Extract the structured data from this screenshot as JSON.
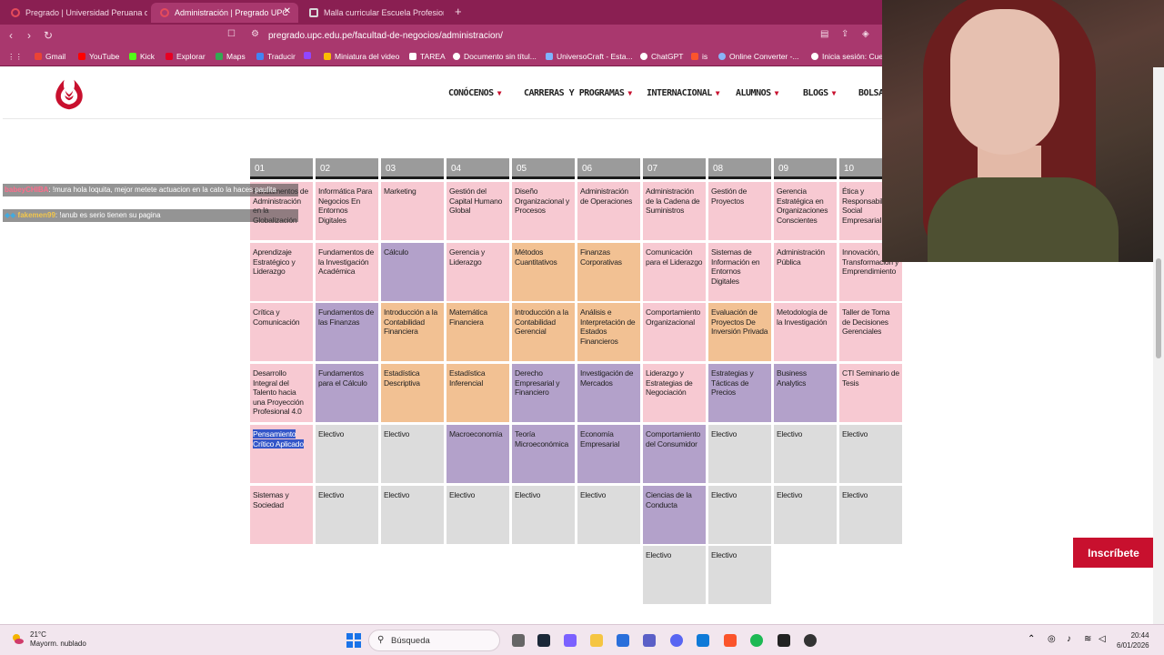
{
  "browser": {
    "tabs": [
      {
        "label": "Pregrado | Universidad Peruana de C",
        "active": false
      },
      {
        "label": "Administración | Pregrado UPC",
        "active": true
      },
      {
        "label": "Malla curricular Escuela Profesional A",
        "active": false
      }
    ],
    "new_tab": "+",
    "url": "pregrado.upc.edu.pe/facultad-de-negocios/administracion/",
    "bookmarks": [
      "Gmail",
      "YouTube",
      "Kick",
      "Explorar",
      "Maps",
      "Traducir",
      "Miniatura del video",
      "TAREA",
      "Documento sin títul...",
      "UniversoCraft - Esta...",
      "ChatGPT",
      "is",
      "Online Converter -...",
      "Inicia sesión: Cuen"
    ]
  },
  "site": {
    "menu": [
      "CONÓCENOS",
      "CARRERAS Y PROGRAMAS",
      "INTERNACIONAL",
      "ALUMNOS",
      "BLOGS",
      "BOLSA"
    ],
    "cta": "Inscríbete",
    "brand_color": "#c8102e"
  },
  "curriculum": {
    "headers": [
      "01",
      "02",
      "03",
      "04",
      "05",
      "06",
      "07",
      "08",
      "09",
      "10"
    ],
    "columns": [
      [
        {
          "text": "Fundamentos de Administración en la Globalización",
          "color": "pink"
        },
        {
          "text": "Aprendizaje Estratégico y Liderazgo",
          "color": "pink"
        },
        {
          "text": "Crítica y Comunicación",
          "color": "pink"
        },
        {
          "text": "Desarrollo Integral del Talento hacia una Proyección Profesional 4.0",
          "color": "pink"
        },
        {
          "text": "Pensamiento Crítico Aplicado",
          "color": "pink"
        },
        {
          "text": "Sistemas y Sociedad",
          "color": "pink"
        }
      ],
      [
        {
          "text": "Informática Para Negocios En Entornos Digitales",
          "color": "pink"
        },
        {
          "text": "Fundamentos de la Investigación Académica",
          "color": "pink"
        },
        {
          "text": "Fundamentos de las Finanzas",
          "color": "purple"
        },
        {
          "text": "Fundamentos para el Cálculo",
          "color": "purple"
        },
        {
          "text": "Electivo",
          "color": "grey"
        },
        {
          "text": "Electivo",
          "color": "grey"
        }
      ],
      [
        {
          "text": "Marketing",
          "color": "pink"
        },
        {
          "text": "Cálculo",
          "color": "purple"
        },
        {
          "text": "Introducción a la Contabilidad Financiera",
          "color": "orange"
        },
        {
          "text": "Estadística Descriptiva",
          "color": "orange"
        },
        {
          "text": "Electivo",
          "color": "grey"
        },
        {
          "text": "Electivo",
          "color": "grey"
        }
      ],
      [
        {
          "text": "Gestión del Capital Humano Global",
          "color": "pink"
        },
        {
          "text": "Gerencia y Liderazgo",
          "color": "pink"
        },
        {
          "text": "Matemática Financiera",
          "color": "orange"
        },
        {
          "text": "Estadística Inferencial",
          "color": "orange"
        },
        {
          "text": "Macroeconomía",
          "color": "purple"
        },
        {
          "text": "Electivo",
          "color": "grey"
        }
      ],
      [
        {
          "text": "Diseño Organizacional y Procesos",
          "color": "pink"
        },
        {
          "text": "Métodos Cuantitativos",
          "color": "orange"
        },
        {
          "text": "Introducción a la Contabilidad Gerencial",
          "color": "orange"
        },
        {
          "text": "Derecho Empresarial y Financiero",
          "color": "purple"
        },
        {
          "text": "Teoría Microeconómica",
          "color": "purple"
        },
        {
          "text": "Electivo",
          "color": "grey"
        }
      ],
      [
        {
          "text": "Administración de Operaciones",
          "color": "pink"
        },
        {
          "text": "Finanzas Corporativas",
          "color": "orange"
        },
        {
          "text": "Análisis e Interpretación de Estados Financieros",
          "color": "orange"
        },
        {
          "text": "Investigación de Mercados",
          "color": "purple"
        },
        {
          "text": "Economía Empresarial",
          "color": "purple"
        },
        {
          "text": "Electivo",
          "color": "grey"
        }
      ],
      [
        {
          "text": "Administración de la Cadena de Suministros",
          "color": "pink"
        },
        {
          "text": "Comunicación para el Liderazgo",
          "color": "pink"
        },
        {
          "text": "Comportamiento Organizacional",
          "color": "pink"
        },
        {
          "text": "Liderazgo y Estrategias de Negociación",
          "color": "pink"
        },
        {
          "text": "Comportamiento del Consumidor",
          "color": "purple"
        },
        {
          "text": "Ciencias de la Conducta",
          "color": "purple"
        },
        {
          "text": "Electivo",
          "color": "grey"
        }
      ],
      [
        {
          "text": "Gestión de Proyectos",
          "color": "pink"
        },
        {
          "text": "Sistemas de Información en Entornos Digitales",
          "color": "pink"
        },
        {
          "text": "Evaluación de Proyectos De Inversión Privada",
          "color": "orange"
        },
        {
          "text": "Estrategias y Tácticas de Precios",
          "color": "purple"
        },
        {
          "text": "Electivo",
          "color": "grey"
        },
        {
          "text": "Electivo",
          "color": "grey"
        },
        {
          "text": "Electivo",
          "color": "grey"
        }
      ],
      [
        {
          "text": "Gerencia Estratégica en Organizaciones Conscientes",
          "color": "pink"
        },
        {
          "text": "Administración Pública",
          "color": "pink"
        },
        {
          "text": "Metodología de la Investigación",
          "color": "pink"
        },
        {
          "text": "Business Analytics",
          "color": "purple"
        },
        {
          "text": "Electivo",
          "color": "grey"
        },
        {
          "text": "Electivo",
          "color": "grey"
        }
      ],
      [
        {
          "text": "Ética y Responsabilidad Social Empresarial",
          "color": "pink"
        },
        {
          "text": "Innovación, Transformación y Emprendimiento",
          "color": "pink"
        },
        {
          "text": "Taller de Toma de Decisiones Gerenciales",
          "color": "pink"
        },
        {
          "text": "CTI Seminario de Tesis",
          "color": "pink"
        },
        {
          "text": "Electivo",
          "color": "grey"
        },
        {
          "text": "Electivo",
          "color": "grey"
        }
      ]
    ],
    "colors": {
      "pink": "#f7c9d2",
      "purple": "#b3a1ca",
      "orange": "#f2c193",
      "grey": "#dcdcdc"
    }
  },
  "chat": [
    {
      "user": "babeyCHIBA",
      "message": ": !mura hola loquita, mejor metete actuacion en la cato  la haces paulita"
    },
    {
      "user": "fakemen99",
      "message": ": !anub es serio tienen su pagina"
    }
  ],
  "taskbar": {
    "weather_temp": "21°C",
    "weather_desc": "Mayorm. nublado",
    "search": "Búsqueda",
    "time": "20:44",
    "date": "6/01/2026"
  }
}
